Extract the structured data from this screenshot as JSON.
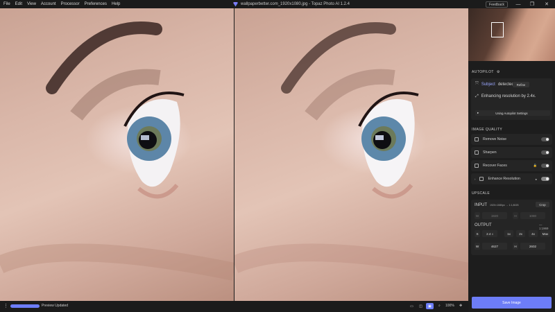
{
  "menu": [
    "File",
    "Edit",
    "View",
    "Account",
    "Processor",
    "Preferences",
    "Help"
  ],
  "window_title": "wallpaperbetter.com_1920x1080.jpg - Topaz Photo AI 1.2.4",
  "feedback_label": "Feedback",
  "window_controls": {
    "minimize": "—",
    "maximize": "❐",
    "close": "✕"
  },
  "autopilot": {
    "title": "AUTOPILOT",
    "subject_label": "Subject",
    "subject_status": "detected.",
    "refine_label": "Refine",
    "enhancing_text": "Enhancing resolution by 2.4x.",
    "settings_label": "Using Autopilot Settings"
  },
  "image_quality": {
    "title": "IMAGE QUALITY",
    "items": [
      {
        "label": "Remove Noise",
        "on": false
      },
      {
        "label": "Sharpen",
        "on": false
      },
      {
        "label": "Recover Faces",
        "on": false
      },
      {
        "label": "Enhance Resolution",
        "on": true
      }
    ]
  },
  "upscale": {
    "title": "UPSCALE",
    "input_label": "INPUT",
    "input_dims": "1920×1080px → 1:1,8025",
    "crop_label": "Crop",
    "input_w_label": "W",
    "input_w": "1920",
    "input_h_label": "H",
    "input_h": "1080",
    "unit": "px",
    "output_label": "OUTPUT",
    "output_ratio": "— 1:1969",
    "scale_label": "S",
    "scale": "2.4",
    "scale_unit": "x",
    "presets": [
      "1x",
      "2x",
      "4x",
      "Max"
    ],
    "out_w_label": "W",
    "out_w": "4627",
    "out_h_label": "H",
    "out_h": "2602"
  },
  "save_label": "Save Image",
  "bottom": {
    "preview_text": "Preview Updated",
    "progress": 1.0,
    "zoom": "100%"
  },
  "colors": {
    "accent": "#6d7df7",
    "panel": "#1d1d1d"
  }
}
